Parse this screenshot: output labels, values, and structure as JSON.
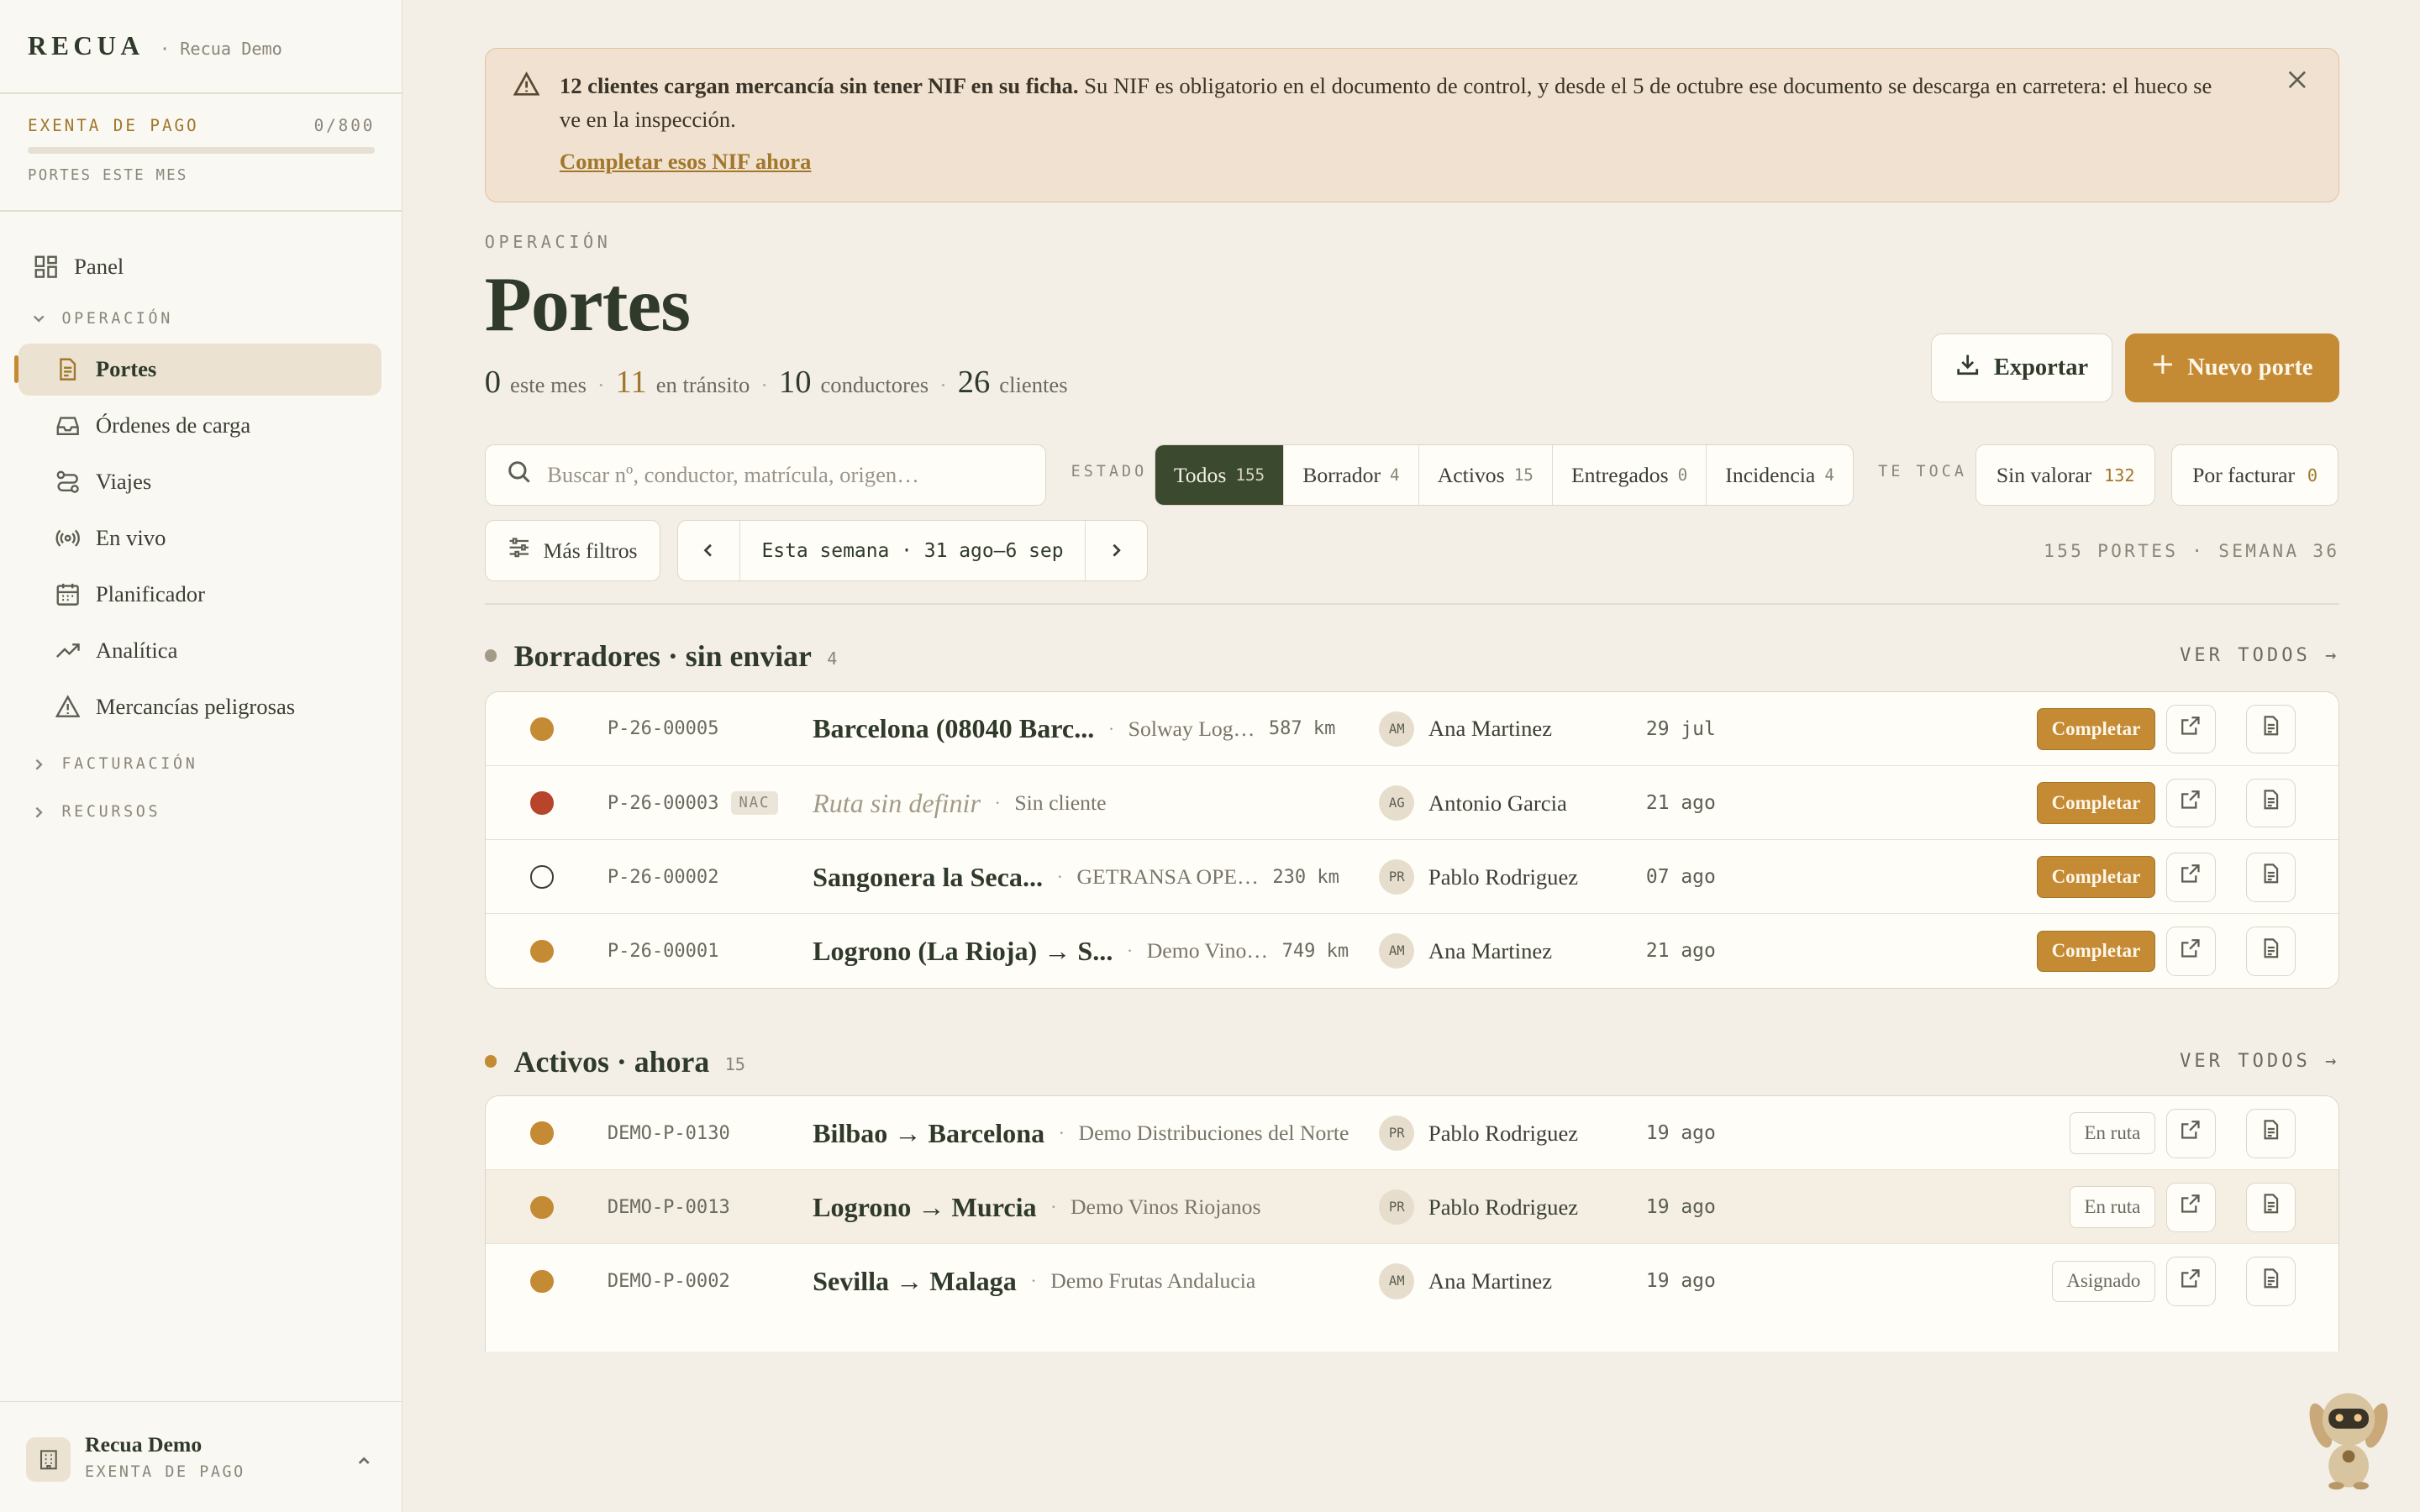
{
  "brand": {
    "logo": "RECUA",
    "workspace": "· Recua Demo"
  },
  "plan": {
    "label": "EXENTA DE PAGO",
    "count": "0/800",
    "progress": 0,
    "sub": "PORTES ESTE MES"
  },
  "nav": {
    "panel": "Panel",
    "operacion_section": "OPERACIÓN",
    "portes": "Portes",
    "ordenes": "Órdenes de carga",
    "viajes": "Viajes",
    "en_vivo": "En vivo",
    "planificador": "Planificador",
    "analitica": "Analítica",
    "mercancias": "Mercancías peligrosas",
    "facturacion_section": "FACTURACIÓN",
    "recursos_section": "RECURSOS"
  },
  "org": {
    "name": "Recua Demo",
    "plan": "EXENTA DE PAGO"
  },
  "alert": {
    "bold": "12 clientes cargan mercancía sin tener NIF en su ficha.",
    "text": " Su NIF es obligatorio en el documento de control, y desde el 5 de octubre ese documento se descarga en carretera: el hueco se ve en la inspección.",
    "link": "Completar esos NIF ahora"
  },
  "header": {
    "eyebrow": "OPERACIÓN",
    "title": "Portes",
    "stats": [
      {
        "num": "0",
        "label": "este mes"
      },
      {
        "num": "11",
        "label": "en tránsito"
      },
      {
        "num": "10",
        "label": "conductores"
      },
      {
        "num": "26",
        "label": "clientes"
      }
    ],
    "export_label": "Exportar",
    "new_label": "Nuevo porte"
  },
  "filters": {
    "search_placeholder": "Buscar nº, conductor, matrícula, origen…",
    "estado_label": "ESTADO",
    "segments": [
      {
        "label": "Todos",
        "count": "155"
      },
      {
        "label": "Borrador",
        "count": "4"
      },
      {
        "label": "Activos",
        "count": "15"
      },
      {
        "label": "Entregados",
        "count": "0"
      },
      {
        "label": "Incidencia",
        "count": "4"
      }
    ],
    "tetoca_label": "TE TOCA",
    "sin_valorar": {
      "label": "Sin valorar",
      "count": "132"
    },
    "por_facturar": {
      "label": "Por facturar",
      "count": "0"
    },
    "more_filters": "Más filtros",
    "week": "Esta semana · 31 ago–6 sep",
    "summary": "155 PORTES · SEMANA 36"
  },
  "sections": {
    "drafts": {
      "title": "Borradores · sin enviar",
      "count": "4",
      "link": "VER TODOS →"
    },
    "active": {
      "title": "Activos · ahora",
      "count": "15",
      "link": "VER TODOS →"
    }
  },
  "drafts_rows": [
    {
      "id": "P-26-00005",
      "tag": "",
      "route": "Barcelona (08040 Barc...",
      "client": "Solway Log…",
      "km": "587 km",
      "initials": "AM",
      "driver": "Ana Martinez",
      "date": "29 jul",
      "action": "Completar",
      "status_color": "#c48a34"
    },
    {
      "id": "P-26-00003",
      "tag": "NAC",
      "route": "Ruta sin definir",
      "client": "Sin cliente",
      "km": "",
      "initials": "AG",
      "driver": "Antonio Garcia",
      "date": "21 ago",
      "action": "Completar",
      "status_color": "#b8452b"
    },
    {
      "id": "P-26-00002",
      "tag": "",
      "route": "Sangonera la Seca...",
      "client": "GETRANSA OPE…",
      "km": "230 km",
      "initials": "PR",
      "driver": "Pablo Rodriguez",
      "date": "07 ago",
      "action": "Completar",
      "status_color": "outline"
    },
    {
      "id": "P-26-00001",
      "tag": "",
      "route": "Logrono (La Rioja) → S...",
      "client": "Demo Vino…",
      "km": "749 km",
      "initials": "AM",
      "driver": "Ana Martinez",
      "date": "21 ago",
      "action": "Completar",
      "status_color": "#c48a34"
    }
  ],
  "active_rows": [
    {
      "id": "DEMO-P-0130",
      "route": "Bilbao → Barcelona",
      "client": "Demo Distribuciones del Norte",
      "initials": "PR",
      "driver": "Pablo Rodriguez",
      "date": "19 ago",
      "status": "En ruta"
    },
    {
      "id": "DEMO-P-0013",
      "route": "Logrono → Murcia",
      "client": "Demo Vinos Riojanos",
      "initials": "PR",
      "driver": "Pablo Rodriguez",
      "date": "19 ago",
      "status": "En ruta"
    },
    {
      "id": "DEMO-P-0002",
      "route": "Sevilla → Malaga",
      "client": "Demo Frutas Andalucia",
      "initials": "AM",
      "driver": "Ana Martinez",
      "date": "19 ago",
      "status": "Asignado"
    }
  ],
  "colors": {
    "accent": "#c48a34",
    "dark": "#3b4a2e",
    "danger": "#b8452b",
    "bg": "#f3efe7"
  }
}
